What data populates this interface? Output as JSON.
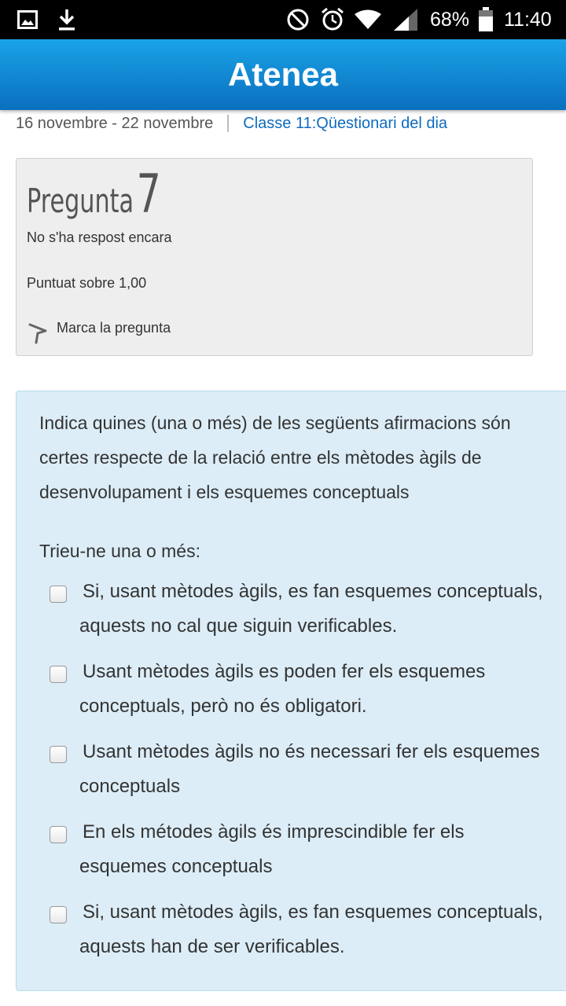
{
  "status_bar": {
    "icons": [
      "image-icon",
      "download-icon",
      "do-not-disturb-icon",
      "alarm-icon",
      "wifi-icon",
      "signal-icon",
      "battery-icon"
    ],
    "battery": "68%",
    "time": "11:40"
  },
  "app_bar": {
    "title": "Atenea"
  },
  "breadcrumb": {
    "week": "16 novembre - 22 novembre",
    "link": "Classe 11:Qüestionari del dia"
  },
  "question_info": {
    "label": "Pregunta",
    "number": "7",
    "state": "No s'ha respost encara",
    "grade": "Puntuat sobre 1,00",
    "flag_label": "Marca la pregunta"
  },
  "question": {
    "text": "Indica quines (una o més) de les següents afirmacions són certes respecte de la relació entre els mètodes àgils de desenvolupament i els esquemes conceptuals",
    "prompt": "Trieu-ne una o més:",
    "options": [
      {
        "label": "Si, usant mètodes àgils, es fan esquemes conceptuals, aquests no cal que siguin verificables.",
        "checked": false
      },
      {
        "label": "Usant mètodes àgils es poden fer els esquemes conceptuals, però no és obligatori.",
        "checked": false
      },
      {
        "label": "Usant mètodes àgils no és necessari fer els esquemes conceptuals",
        "checked": false
      },
      {
        "label": "En els métodes àgils és imprescindible fer els esquemes conceptuals",
        "checked": false
      },
      {
        "label": "Si, usant mètodes àgils, es fan esquemes conceptuals, aquests han de ser verificables.",
        "checked": false
      }
    ]
  },
  "colors": {
    "accent": "#0f6cbf",
    "appbar_top": "#1aa3e6",
    "appbar_bottom": "#0a6fbf",
    "question_bg": "#dcedf7",
    "info_bg": "#eeeeee"
  }
}
